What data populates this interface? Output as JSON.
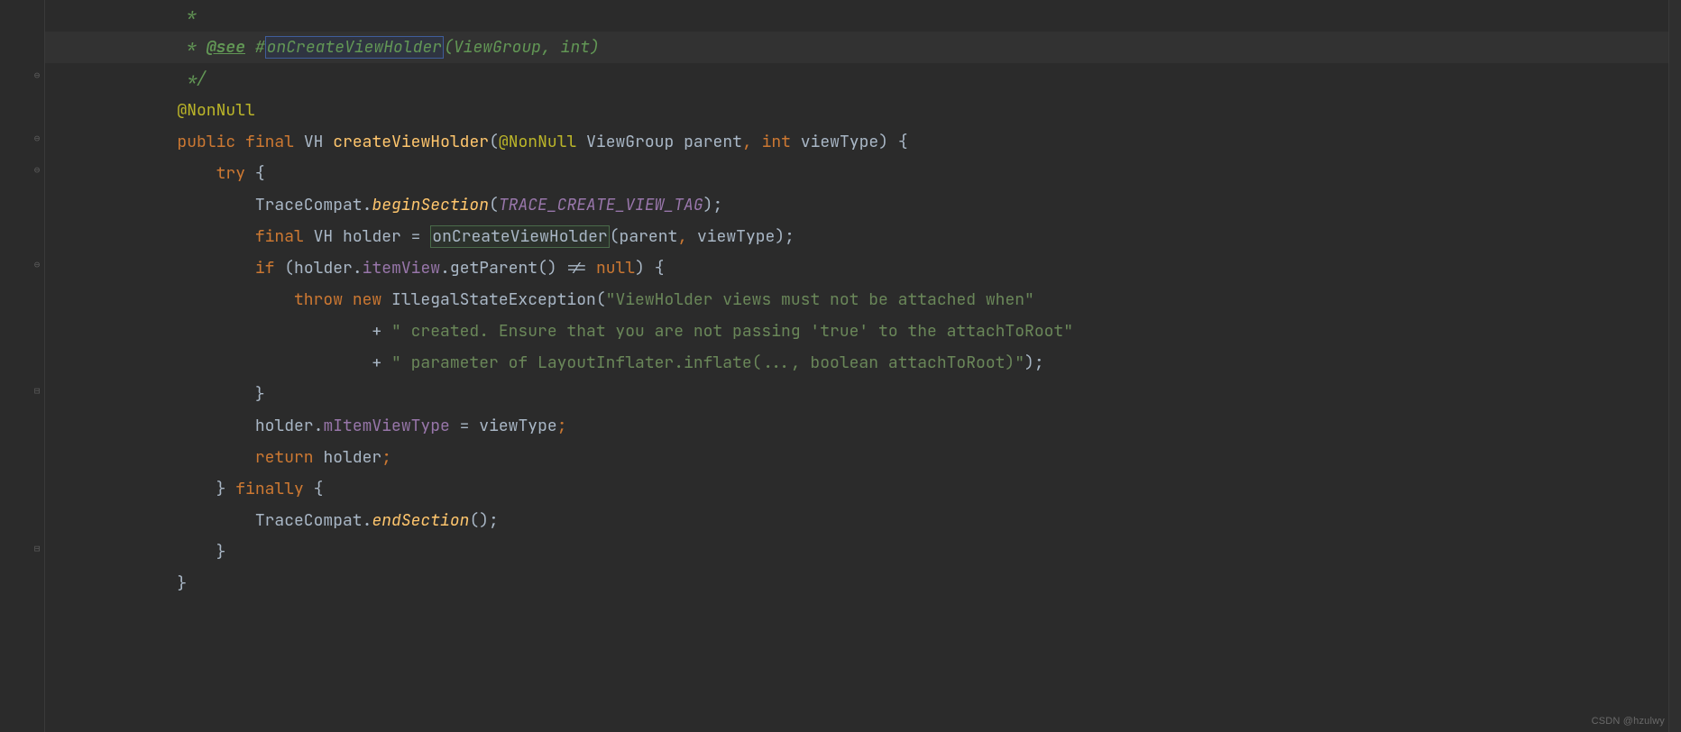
{
  "watermark": "CSDN @hzulwy",
  "code": {
    "l1": {
      "indent": "         ",
      "star": "*"
    },
    "l2": {
      "indent": "         ",
      "prefix": "* ",
      "see": "@see",
      "sp": " ",
      "hash": "#",
      "link": "onCreateViewHolder",
      "sig": "(ViewGroup, int)"
    },
    "l3": {
      "indent": "         ",
      "close": "*/"
    },
    "l4": {
      "indent": "        ",
      "anno": "@NonNull"
    },
    "l5": {
      "indent": "        ",
      "kw1": "public",
      "sp1": " ",
      "kw2": "final",
      "sp2": " ",
      "type": "VH",
      "sp3": " ",
      "name": "createViewHolder",
      "open": "(",
      "anno": "@NonNull",
      "sp4": " ",
      "p1t": "ViewGroup",
      "sp5": " ",
      "p1n": "parent",
      "comma": ",",
      "sp6": " ",
      "p2t": "int",
      "sp7": " ",
      "p2n": "viewType",
      "close": ")",
      "sp8": " ",
      "brace": "{"
    },
    "l6": {
      "indent": "            ",
      "kw": "try",
      "sp": " ",
      "brace": "{"
    },
    "l7": {
      "indent": "                ",
      "cls": "TraceCompat",
      "dot": ".",
      "m": "beginSection",
      "open": "(",
      "arg": "TRACE_CREATE_VIEW_TAG",
      "close": ");"
    },
    "l8": {
      "indent": "                ",
      "kw1": "final",
      "sp1": " ",
      "type": "VH",
      "sp2": " ",
      "var": "holder",
      "sp3": " ",
      "eq": "=",
      "sp4": " ",
      "call": "onCreateViewHolder",
      "open": "(",
      "a1": "parent",
      "comma": ",",
      "sp5": " ",
      "a2": "viewType",
      "close": ");"
    },
    "l9": {
      "indent": "                ",
      "kw": "if",
      "sp": " ",
      "open": "(",
      "v": "holder",
      "dot1": ".",
      "f": "itemView",
      "dot2": ".",
      "m": "getParent",
      "call": "()",
      "sp2": " ",
      "neq": "!=",
      "sp3": " ",
      "nul": "null",
      "close": ")",
      "sp4": " ",
      "brace": "{"
    },
    "l10": {
      "indent": "                    ",
      "kw1": "throw",
      "sp1": " ",
      "kw2": "new",
      "sp2": " ",
      "cls": "IllegalStateException",
      "open": "(",
      "s": "\"ViewHolder views must not be attached when\""
    },
    "l11": {
      "indent": "                            ",
      "plus": "+",
      "sp": " ",
      "s": "\" created. Ensure that you are not passing 'true' to the attachToRoot\""
    },
    "l12": {
      "indent": "                            ",
      "plus": "+",
      "sp": " ",
      "s": "\" parameter of LayoutInflater.inflate(..., boolean attachToRoot)\"",
      "close": ");"
    },
    "l13": {
      "indent": "                ",
      "brace": "}"
    },
    "l14": {
      "indent": "                ",
      "v": "holder",
      "dot": ".",
      "f": "mItemViewType",
      "sp1": " ",
      "eq": "=",
      "sp2": " ",
      "rhs": "viewType",
      "semi": ";"
    },
    "l15": {
      "indent": "                ",
      "kw": "return",
      "sp": " ",
      "v": "holder",
      "semi": ";"
    },
    "l16": {
      "indent": "            ",
      "brace": "}",
      "sp": " ",
      "kw": "finally",
      "sp2": " ",
      "brace2": "{"
    },
    "l17": {
      "indent": "                ",
      "cls": "TraceCompat",
      "dot": ".",
      "m": "endSection",
      "call": "();"
    },
    "l18": {
      "indent": "            ",
      "brace": "}"
    },
    "l19": {
      "indent": "        ",
      "brace": "}"
    }
  }
}
